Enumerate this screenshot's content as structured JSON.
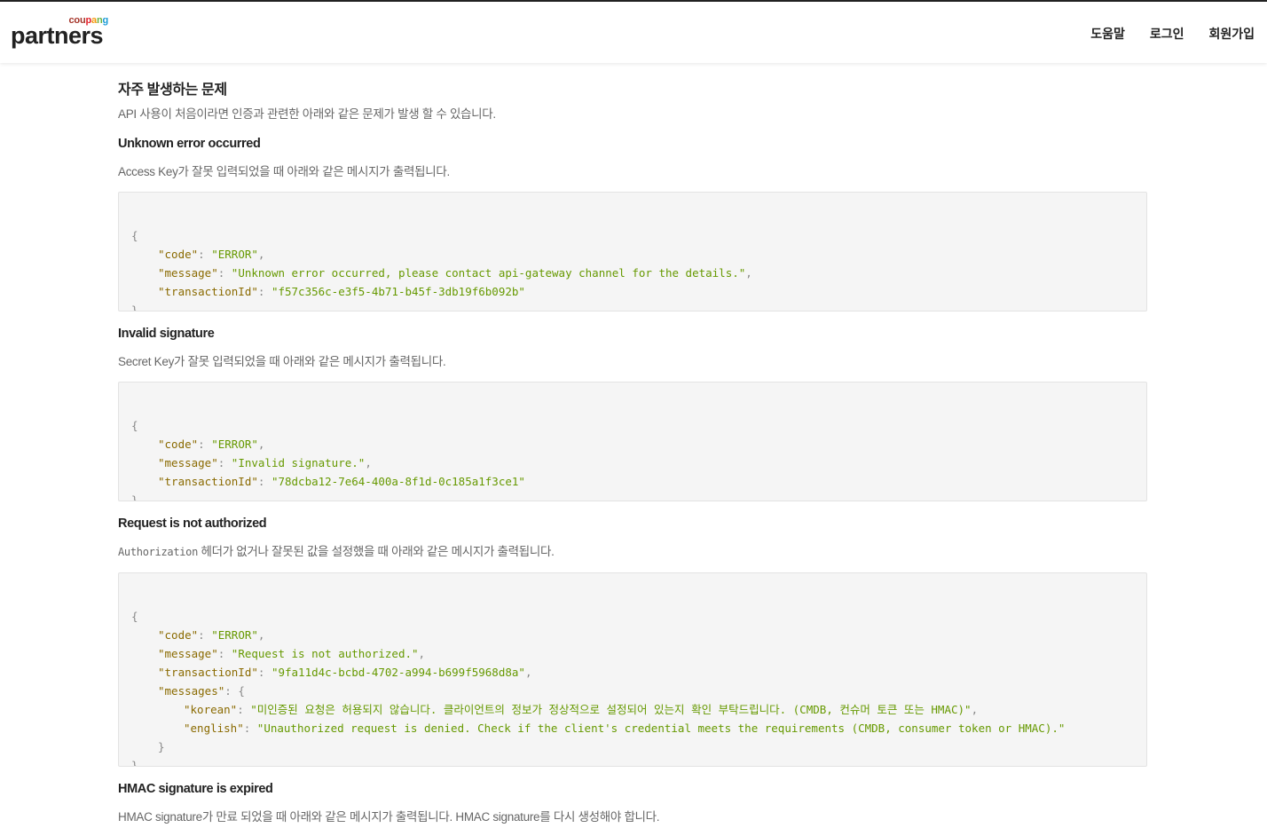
{
  "header": {
    "logo_top": [
      "cou",
      "p",
      "a",
      "n",
      "g"
    ],
    "logo_main": "partners",
    "nav": [
      "도움말",
      "로그인",
      "회원가입"
    ]
  },
  "page": {
    "title": "자주 발생하는 문제",
    "intro": "API 사용이 처음이라면 인증과 관련한 아래와 같은 문제가 발생 할 수 있습니다."
  },
  "sections": [
    {
      "title": "Unknown error occurred",
      "desc": "Access Key가 잘못 입력되었을 때 아래와 같은 메시지가 출력됩니다.",
      "code": {
        "code": "\"ERROR\"",
        "message": "\"Unknown error occurred, please contact api-gateway channel for the details.\"",
        "transactionId": "\"f57c356c-e3f5-4b71-b45f-3db19f6b092b\""
      }
    },
    {
      "title": "Invalid signature",
      "desc": "Secret Key가 잘못 입력되었을 때 아래와 같은 메시지가 출력됩니다.",
      "code": {
        "code": "\"ERROR\"",
        "message": "\"Invalid signature.\"",
        "transactionId": "\"78dcba12-7e64-400a-8f1d-0c185a1f3ce1\""
      }
    },
    {
      "title": "Request is not authorized",
      "desc_code": "Authorization",
      "desc": " 헤더가 없거나 잘못된 값을 설정했을 때 아래와 같은 메시지가 출력됩니다.",
      "code": {
        "code": "\"ERROR\"",
        "message": "\"Request is not authorized.\"",
        "transactionId": "\"9fa11d4c-bcbd-4702-a994-b699f5968d8a\"",
        "korean": "\"미인증된 요청은 허용되지 않습니다. 클라이언트의 정보가 정상적으로 설정되어 있는지 확인 부탁드립니다. (CMDB, 컨슈머 토큰 또는 HMAC)\"",
        "english": "\"Unauthorized request is denied. Check if the client's credential meets the requirements (CMDB, consumer token or HMAC).\""
      }
    },
    {
      "title": "HMAC signature is expired",
      "desc": "HMAC signature가 만료 되었을 때 아래와 같은 메시지가 출력됩니다. HMAC signature를 다시 생성해야 합니다."
    }
  ],
  "code_tokens": {
    "open": "{",
    "close": "}",
    "key_code": "\"code\"",
    "key_message": "\"message\"",
    "key_transaction": "\"transactionId\"",
    "key_messages": "\"messages\"",
    "key_korean": "\"korean\"",
    "key_english": "\"english\"",
    "colon": ": ",
    "comma": ",",
    "colon_open": ": {",
    "close_comma": "}"
  },
  "colors": {
    "key": "#8a6a00",
    "string": "#669900",
    "code_bg": "#f5f5f5"
  }
}
